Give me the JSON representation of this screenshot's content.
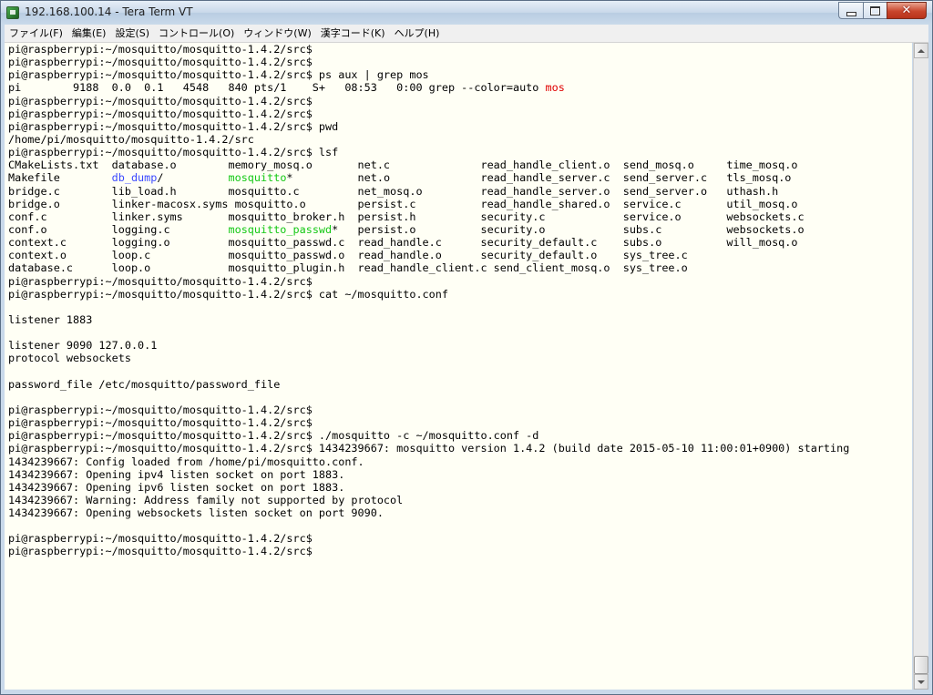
{
  "window": {
    "title": "192.168.100.14 - Tera Term VT"
  },
  "menu": [
    {
      "label": "ファイル(F)"
    },
    {
      "label": "編集(E)"
    },
    {
      "label": "設定(S)"
    },
    {
      "label": "コントロール(O)"
    },
    {
      "label": "ウィンドウ(W)"
    },
    {
      "label": "漢字コード(K)"
    },
    {
      "label": "ヘルプ(H)"
    }
  ],
  "terminal": {
    "lines": [
      [
        {
          "t": "pi@raspberrypi:~/mosquitto/mosquitto-1.4.2/src$"
        }
      ],
      [
        {
          "t": "pi@raspberrypi:~/mosquitto/mosquitto-1.4.2/src$"
        }
      ],
      [
        {
          "t": "pi@raspberrypi:~/mosquitto/mosquitto-1.4.2/src$ ps aux | grep mos"
        }
      ],
      [
        {
          "t": "pi        9188  0.0  0.1   4548   840 pts/1    S+   08:53   0:00 grep --color=auto "
        },
        {
          "t": "mos",
          "c": "red"
        }
      ],
      [
        {
          "t": "pi@raspberrypi:~/mosquitto/mosquitto-1.4.2/src$"
        }
      ],
      [
        {
          "t": "pi@raspberrypi:~/mosquitto/mosquitto-1.4.2/src$"
        }
      ],
      [
        {
          "t": "pi@raspberrypi:~/mosquitto/mosquitto-1.4.2/src$ pwd"
        }
      ],
      [
        {
          "t": "/home/pi/mosquitto/mosquitto-1.4.2/src"
        }
      ],
      [
        {
          "t": "pi@raspberrypi:~/mosquitto/mosquitto-1.4.2/src$ lsf"
        }
      ],
      [
        {
          "t": "CMakeLists.txt  database.o        memory_mosq.o       net.c              read_handle_client.o  send_mosq.o     time_mosq.o"
        }
      ],
      [
        {
          "t": "Makefile        "
        },
        {
          "t": "db_dump",
          "c": "blue"
        },
        {
          "t": "/          "
        },
        {
          "t": "mosquitto",
          "c": "green"
        },
        {
          "t": "*          net.o              read_handle_server.c  send_server.c   tls_mosq.o"
        }
      ],
      [
        {
          "t": "bridge.c        lib_load.h        mosquitto.c         net_mosq.o         read_handle_server.o  send_server.o   uthash.h"
        }
      ],
      [
        {
          "t": "bridge.o        linker-macosx.syms mosquitto.o        persist.c          read_handle_shared.o  service.c       util_mosq.o"
        }
      ],
      [
        {
          "t": "conf.c          linker.syms       mosquitto_broker.h  persist.h          security.c            service.o       websockets.c"
        }
      ],
      [
        {
          "t": "conf.o          logging.c         "
        },
        {
          "t": "mosquitto_passwd",
          "c": "green"
        },
        {
          "t": "*   persist.o          security.o            subs.c          websockets.o"
        }
      ],
      [
        {
          "t": "context.c       logging.o         mosquitto_passwd.c  read_handle.c      security_default.c    subs.o          will_mosq.o"
        }
      ],
      [
        {
          "t": "context.o       loop.c            mosquitto_passwd.o  read_handle.o      security_default.o    sys_tree.c"
        }
      ],
      [
        {
          "t": "database.c      loop.o            mosquitto_plugin.h  read_handle_client.c send_client_mosq.o  sys_tree.o"
        }
      ],
      [
        {
          "t": "pi@raspberrypi:~/mosquitto/mosquitto-1.4.2/src$"
        }
      ],
      [
        {
          "t": "pi@raspberrypi:~/mosquitto/mosquitto-1.4.2/src$ cat ~/mosquitto.conf"
        }
      ],
      [
        {
          "t": ""
        }
      ],
      [
        {
          "t": "listener 1883"
        }
      ],
      [
        {
          "t": ""
        }
      ],
      [
        {
          "t": "listener 9090 127.0.0.1"
        }
      ],
      [
        {
          "t": "protocol websockets"
        }
      ],
      [
        {
          "t": ""
        }
      ],
      [
        {
          "t": "password_file /etc/mosquitto/password_file"
        }
      ],
      [
        {
          "t": ""
        }
      ],
      [
        {
          "t": "pi@raspberrypi:~/mosquitto/mosquitto-1.4.2/src$"
        }
      ],
      [
        {
          "t": "pi@raspberrypi:~/mosquitto/mosquitto-1.4.2/src$"
        }
      ],
      [
        {
          "t": "pi@raspberrypi:~/mosquitto/mosquitto-1.4.2/src$ ./mosquitto -c ~/mosquitto.conf -d"
        }
      ],
      [
        {
          "t": "pi@raspberrypi:~/mosquitto/mosquitto-1.4.2/src$ 1434239667: mosquitto version 1.4.2 (build date 2015-05-10 11:00:01+0900) starting"
        }
      ],
      [
        {
          "t": "1434239667: Config loaded from /home/pi/mosquitto.conf."
        }
      ],
      [
        {
          "t": "1434239667: Opening ipv4 listen socket on port 1883."
        }
      ],
      [
        {
          "t": "1434239667: Opening ipv6 listen socket on port 1883."
        }
      ],
      [
        {
          "t": "1434239667: Warning: Address family not supported by protocol"
        }
      ],
      [
        {
          "t": "1434239667: Opening websockets listen socket on port 9090."
        }
      ],
      [
        {
          "t": ""
        }
      ],
      [
        {
          "t": "pi@raspberrypi:~/mosquitto/mosquitto-1.4.2/src$"
        }
      ],
      [
        {
          "t": "pi@raspberrypi:~/mosquitto/mosquitto-1.4.2/src$"
        }
      ]
    ]
  },
  "colors": {
    "red": "#e00000",
    "blue": "#3a48ff",
    "green": "#14c814"
  },
  "icons": {
    "app": "teraterm-icon",
    "minimize": "minimize-icon",
    "maximize": "maximize-icon",
    "close": "close-icon",
    "scroll_up": "arrow-up-icon",
    "scroll_down": "arrow-down-icon"
  }
}
